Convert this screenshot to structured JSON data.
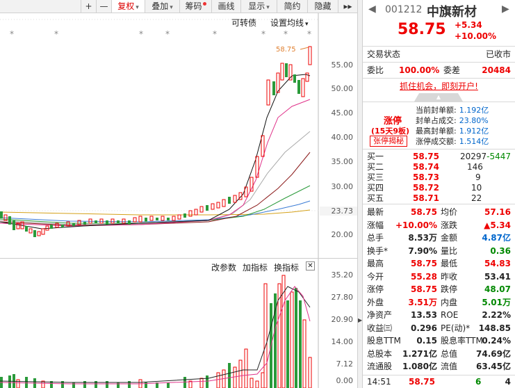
{
  "toolbar": {
    "plus": "+",
    "minus": "—",
    "adjust": "复权",
    "overlay": "叠加",
    "chips": "筹码",
    "draw": "画线",
    "display": "显示",
    "simple": "简约",
    "hide": "隐藏",
    "more": "▸▸"
  },
  "kline": {
    "convertible": "可转债",
    "set_ma": "设置均线",
    "price_labels": [
      "55.00",
      "50.00",
      "45.00",
      "40.00",
      "35.00",
      "30.00",
      "23.73",
      "20.00"
    ],
    "high_marker": "58.75"
  },
  "volume": {
    "modify_params": "改参数",
    "add_indicator": "加指标",
    "change_indicator": "换指标",
    "labels": [
      "35.20",
      "27.80",
      "20.90",
      "14.00",
      "7.12",
      "0.00"
    ]
  },
  "stock": {
    "code": "001212",
    "name": "中旗新材",
    "price": "58.75",
    "change": "+5.34",
    "change_pct": "+10.00%"
  },
  "status": {
    "label": "交易状态",
    "value": "已收市"
  },
  "ratio": {
    "label1": "委比",
    "value1": "100.00%",
    "label2": "委差",
    "value2": "20484"
  },
  "banner": "抓住机会，即刻开户!",
  "limit": {
    "title": "涨停",
    "streak": "(15天9板)",
    "reveal": "张停揭秘",
    "items": [
      {
        "label": "当前封单额:",
        "value": "1.192亿"
      },
      {
        "label": "封单占成交:",
        "value": "23.80%"
      },
      {
        "label": "最高封单额:",
        "value": "1.912亿"
      },
      {
        "label": "涨停成交额:",
        "value": "1.514亿"
      }
    ]
  },
  "bids": [
    {
      "label": "买一",
      "price": "58.75",
      "qty": "20297",
      "delta": "-5447"
    },
    {
      "label": "买二",
      "price": "58.74",
      "qty": "146",
      "delta": ""
    },
    {
      "label": "买三",
      "price": "58.73",
      "qty": "9",
      "delta": ""
    },
    {
      "label": "买四",
      "price": "58.72",
      "qty": "10",
      "delta": ""
    },
    {
      "label": "买五",
      "price": "58.71",
      "qty": "22",
      "delta": ""
    }
  ],
  "stats": [
    {
      "l1": "最新",
      "v1": "58.75",
      "c1": "red",
      "l2": "均价",
      "v2": "57.16",
      "c2": "red"
    },
    {
      "l1": "涨幅",
      "v1": "+10.00%",
      "c1": "red",
      "l2": "涨跌",
      "v2": "▲5.34",
      "c2": "red"
    },
    {
      "l1": "总手",
      "v1": "8.53万",
      "c1": "",
      "l2": "金额",
      "v2": "4.87亿",
      "c2": "blue"
    },
    {
      "l1": "换手*",
      "v1": "7.90%",
      "c1": "",
      "l2": "量比",
      "v2": "0.36",
      "c2": "green"
    },
    {
      "l1": "最高",
      "v1": "58.75",
      "c1": "red",
      "l2": "最低",
      "v2": "54.83",
      "c2": "red"
    },
    {
      "l1": "今开",
      "v1": "55.28",
      "c1": "red",
      "l2": "昨收",
      "v2": "53.41",
      "c2": ""
    },
    {
      "l1": "涨停",
      "v1": "58.75",
      "c1": "red",
      "l2": "跌停",
      "v2": "48.07",
      "c2": "green"
    },
    {
      "l1": "外盘",
      "v1": "3.51万",
      "c1": "red",
      "l2": "内盘",
      "v2": "5.01万",
      "c2": "green"
    },
    {
      "l1": "净资产",
      "v1": "13.53",
      "c1": "",
      "l2": "ROE",
      "v2": "2.22%",
      "c2": ""
    },
    {
      "l1": "收益㈢",
      "v1": "0.296",
      "c1": "",
      "l2": "PE(动)*",
      "v2": "148.85",
      "c2": ""
    },
    {
      "l1": "股息TTM",
      "v1": "0.15",
      "c1": "",
      "l2": "股息率TTM",
      "v2": "0.24%",
      "c2": ""
    },
    {
      "l1": "总股本",
      "v1": "1.271亿",
      "c1": "",
      "l2": "总值",
      "v2": "74.69亿",
      "c2": ""
    },
    {
      "l1": "流通股",
      "v1": "1.080亿",
      "c1": "",
      "l2": "流值",
      "v2": "63.45亿",
      "c2": ""
    }
  ],
  "footer": {
    "time": "14:51",
    "price": "58.75",
    "vol": "6",
    "count": "4"
  }
}
